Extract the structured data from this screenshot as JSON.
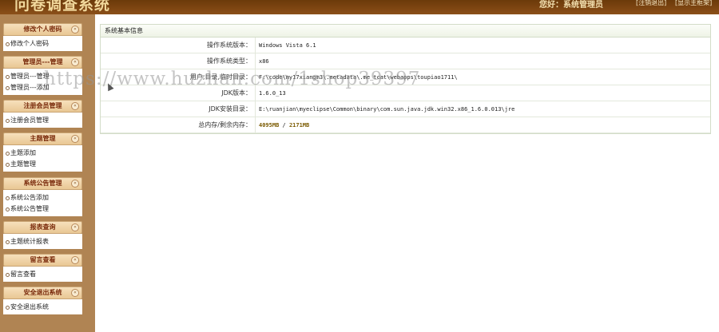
{
  "header": {
    "title": "问卷调查系统",
    "greeting": "您好：系统管理员",
    "logout_label": "[注销退出]",
    "home_label": "[显示主框架]"
  },
  "sidebar": {
    "groups": [
      {
        "title": "修改个人密码",
        "items": [
          "修改个人密码"
        ]
      },
      {
        "title": "管理员---管理",
        "items": [
          "管理员---管理",
          "管理员---添加"
        ]
      },
      {
        "title": "注册会员管理",
        "items": [
          "注册会员管理"
        ]
      },
      {
        "title": "主题管理",
        "items": [
          "主题添加",
          "主题管理"
        ]
      },
      {
        "title": "系统公告管理",
        "items": [
          "系统公告添加",
          "系统公告管理"
        ]
      },
      {
        "title": "报表查询",
        "items": [
          "主题统计报表"
        ]
      },
      {
        "title": "留言查看",
        "items": [
          "留言查看"
        ]
      },
      {
        "title": "安全退出系统",
        "items": [
          "安全退出系统"
        ]
      }
    ],
    "toggle_glyph": "«"
  },
  "main": {
    "panel_title": "系统基本信息",
    "rows": [
      {
        "label": "操作系统版本：",
        "value": "Windows Vista  6.1"
      },
      {
        "label": "操作系统类型：",
        "value": "x86"
      },
      {
        "label": "用户,目录,临时目录：",
        "value": "F:\\code\\my17xiangm3\\.metadata\\.me_tcat\\webapps\\toupiao1711\\"
      },
      {
        "label": "JDK版本：",
        "value": "1.6.0_13"
      },
      {
        "label": "JDK安装目录：",
        "value": "E:\\ruanjian\\myeclipse\\Common\\binary\\com.sun.java.jdk.win32.x86_1.6.0.013\\jre"
      },
      {
        "label": "总内存/剩余内存：",
        "value_total": "4095MB",
        "value_sep": " / ",
        "value_free": "2171MB"
      }
    ]
  },
  "watermark": "https://www.huzhan.com/1shop39397"
}
